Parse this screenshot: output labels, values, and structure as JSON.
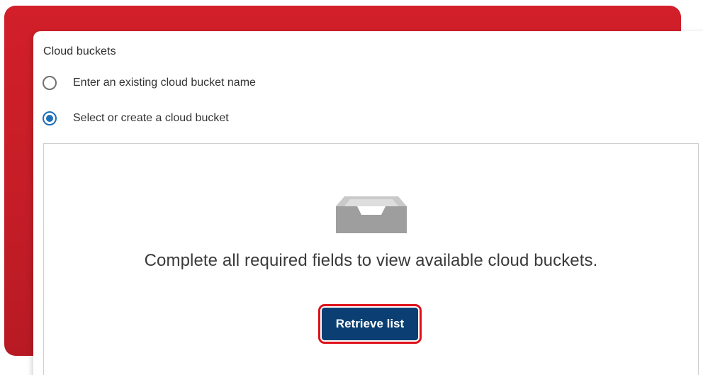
{
  "section": {
    "title": "Cloud buckets"
  },
  "options": [
    {
      "label": "Enter an existing cloud bucket name",
      "selected": false
    },
    {
      "label": "Select or create a cloud bucket",
      "selected": true
    }
  ],
  "panel": {
    "icon": "empty-tray-icon",
    "message": "Complete all required fields to view available cloud buckets.",
    "button_label": "Retrieve list"
  },
  "colors": {
    "highlight_border": "#e0101a",
    "button_bg": "#0b3f73",
    "radio_selected": "#1f6fb8",
    "backdrop": "#c51d27"
  }
}
